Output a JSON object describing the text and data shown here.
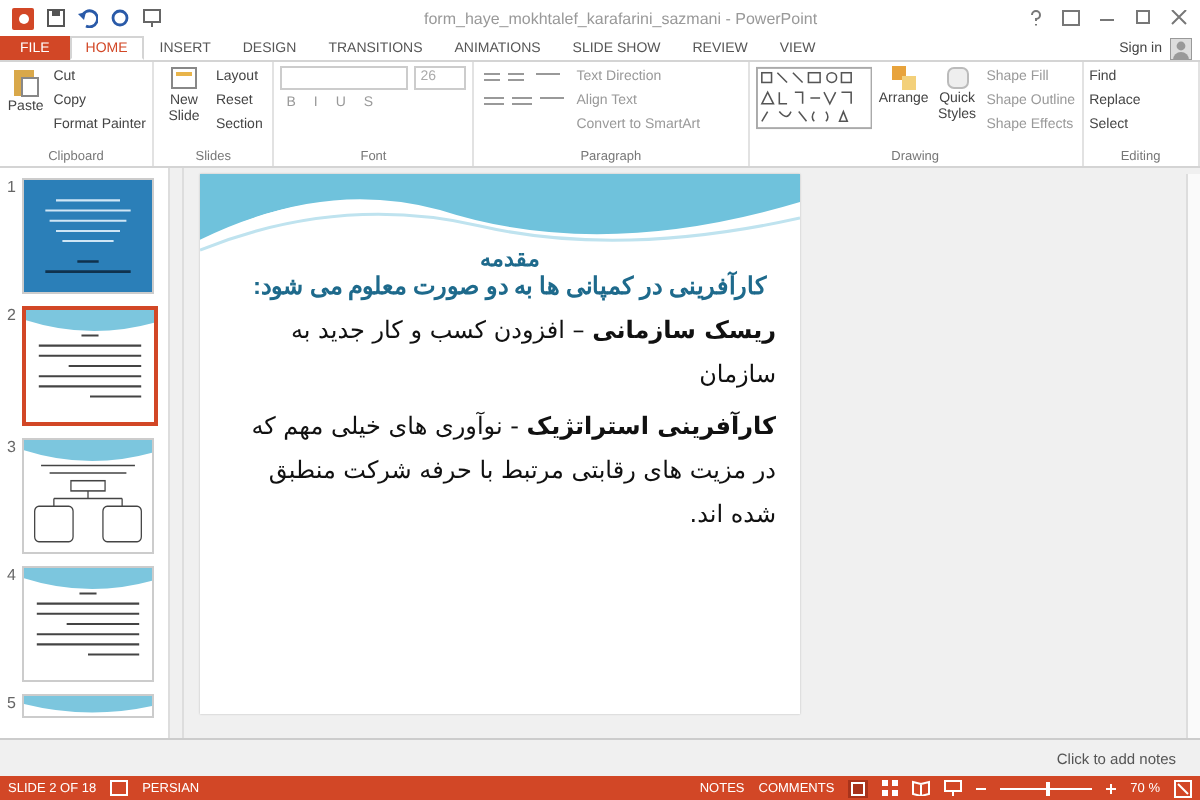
{
  "window": {
    "title": "form_haye_mokhtalef_karafarini_sazmani - PowerPoint",
    "sign_in": "Sign in"
  },
  "tabs": [
    {
      "label": "FILE",
      "kind": "file",
      "selected": false
    },
    {
      "label": "HOME",
      "kind": "tab",
      "selected": true
    },
    {
      "label": "INSERT",
      "kind": "tab",
      "selected": false
    },
    {
      "label": "DESIGN",
      "kind": "tab",
      "selected": false
    },
    {
      "label": "TRANSITIONS",
      "kind": "tab",
      "selected": false
    },
    {
      "label": "ANIMATIONS",
      "kind": "tab",
      "selected": false
    },
    {
      "label": "SLIDE SHOW",
      "kind": "tab",
      "selected": false
    },
    {
      "label": "REVIEW",
      "kind": "tab",
      "selected": false
    },
    {
      "label": "VIEW",
      "kind": "tab",
      "selected": false
    }
  ],
  "ribbon": {
    "clipboard": {
      "label": "Clipboard",
      "paste": "Paste",
      "items": [
        "Cut",
        "Copy",
        "Format Painter"
      ]
    },
    "slides": {
      "label": "Slides",
      "new_slide": "New Slide",
      "items": [
        "Layout",
        "Reset",
        "Section"
      ]
    },
    "font": {
      "label": "Font",
      "size": "26",
      "styles": [
        "B",
        "I",
        "U",
        "S"
      ]
    },
    "paragraph": {
      "label": "Paragraph",
      "items": [
        "Text Direction",
        "Align Text",
        "Convert to SmartArt"
      ]
    },
    "drawing": {
      "label": "Drawing",
      "arrange": "Arrange",
      "quick_styles": "Quick Styles",
      "items": [
        "Shape Fill",
        "Shape Outline",
        "Shape Effects"
      ]
    },
    "editing": {
      "label": "Editing",
      "items": [
        "Find",
        "Replace",
        "Select"
      ]
    }
  },
  "thumbnails": [
    {
      "number": "1",
      "kind": "dark",
      "selected": false
    },
    {
      "number": "2",
      "kind": "text",
      "selected": true
    },
    {
      "number": "3",
      "kind": "diagram",
      "selected": false
    },
    {
      "number": "4",
      "kind": "text",
      "selected": false
    },
    {
      "number": "5",
      "kind": "partial",
      "selected": false
    }
  ],
  "slide": {
    "heading": "مقدمه",
    "subheading": "کارآفرینی در کمپانی ها به دو صورت معلوم می شود:",
    "paragraphs": [
      "**ریسک سازمانی** – افزودن کسب و کار جدید به سازمان",
      "**کارآفرینی استراتژیک** - نوآوری های خیلی مهم که  در مزیت های رقابتی مرتبط با حرفه شرکت منطبق  شده اند."
    ]
  },
  "notes": {
    "placeholder": "Click to add notes"
  },
  "status_bar": {
    "slide": "SLIDE 2 OF 18",
    "language": "PERSIAN",
    "notes": "NOTES",
    "comments": "COMMENTS",
    "zoom": "70 %",
    "level": 0.5
  }
}
